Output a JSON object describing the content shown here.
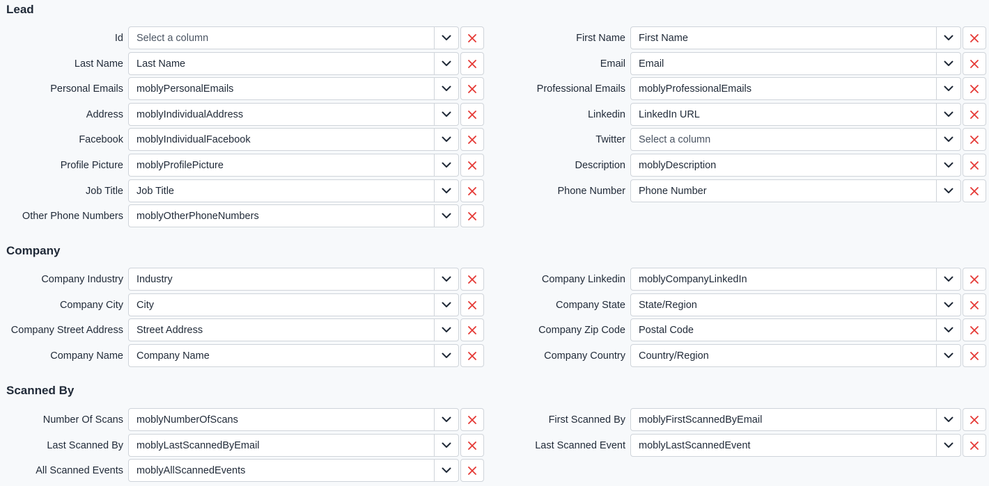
{
  "sections": [
    {
      "title": "Lead",
      "left": [
        {
          "label": "Id",
          "value": "Select a column",
          "placeholder": true
        },
        {
          "label": "Last Name",
          "value": "Last Name"
        },
        {
          "label": "Personal Emails",
          "value": "moblyPersonalEmails"
        },
        {
          "label": "Address",
          "value": "moblyIndividualAddress"
        },
        {
          "label": "Facebook",
          "value": "moblyIndividualFacebook"
        },
        {
          "label": "Profile Picture",
          "value": "moblyProfilePicture"
        },
        {
          "label": "Job Title",
          "value": "Job Title"
        },
        {
          "label": "Other Phone Numbers",
          "value": "moblyOtherPhoneNumbers"
        }
      ],
      "right": [
        {
          "label": "First Name",
          "value": "First Name"
        },
        {
          "label": "Email",
          "value": "Email"
        },
        {
          "label": "Professional Emails",
          "value": "moblyProfessionalEmails"
        },
        {
          "label": "Linkedin",
          "value": "LinkedIn URL"
        },
        {
          "label": "Twitter",
          "value": "Select a column",
          "placeholder": true
        },
        {
          "label": "Description",
          "value": "moblyDescription"
        },
        {
          "label": "Phone Number",
          "value": "Phone Number"
        }
      ]
    },
    {
      "title": "Company",
      "left": [
        {
          "label": "Company Industry",
          "value": "Industry"
        },
        {
          "label": "Company City",
          "value": "City"
        },
        {
          "label": "Company Street Address",
          "value": "Street Address"
        },
        {
          "label": "Company Name",
          "value": "Company Name"
        }
      ],
      "right": [
        {
          "label": "Company Linkedin",
          "value": "moblyCompanyLinkedIn"
        },
        {
          "label": "Company State",
          "value": "State/Region"
        },
        {
          "label": "Company Zip Code",
          "value": "Postal Code"
        },
        {
          "label": "Company Country",
          "value": "Country/Region"
        }
      ]
    },
    {
      "title": "Scanned By",
      "left": [
        {
          "label": "Number Of Scans",
          "value": "moblyNumberOfScans"
        },
        {
          "label": "Last Scanned By",
          "value": "moblyLastScannedByEmail"
        },
        {
          "label": "All Scanned Events",
          "value": "moblyAllScannedEvents"
        }
      ],
      "right": [
        {
          "label": "First Scanned By",
          "value": "moblyFirstScannedByEmail"
        },
        {
          "label": "Last Scanned Event",
          "value": "moblyLastScannedEvent"
        }
      ]
    }
  ],
  "icons": {
    "dropdown": "chevron-down-icon",
    "clear": "close-icon"
  },
  "colors": {
    "clear_icon": "#e53935",
    "chevron_icon": "#1f2937",
    "placeholder_text": "#4b5563"
  }
}
